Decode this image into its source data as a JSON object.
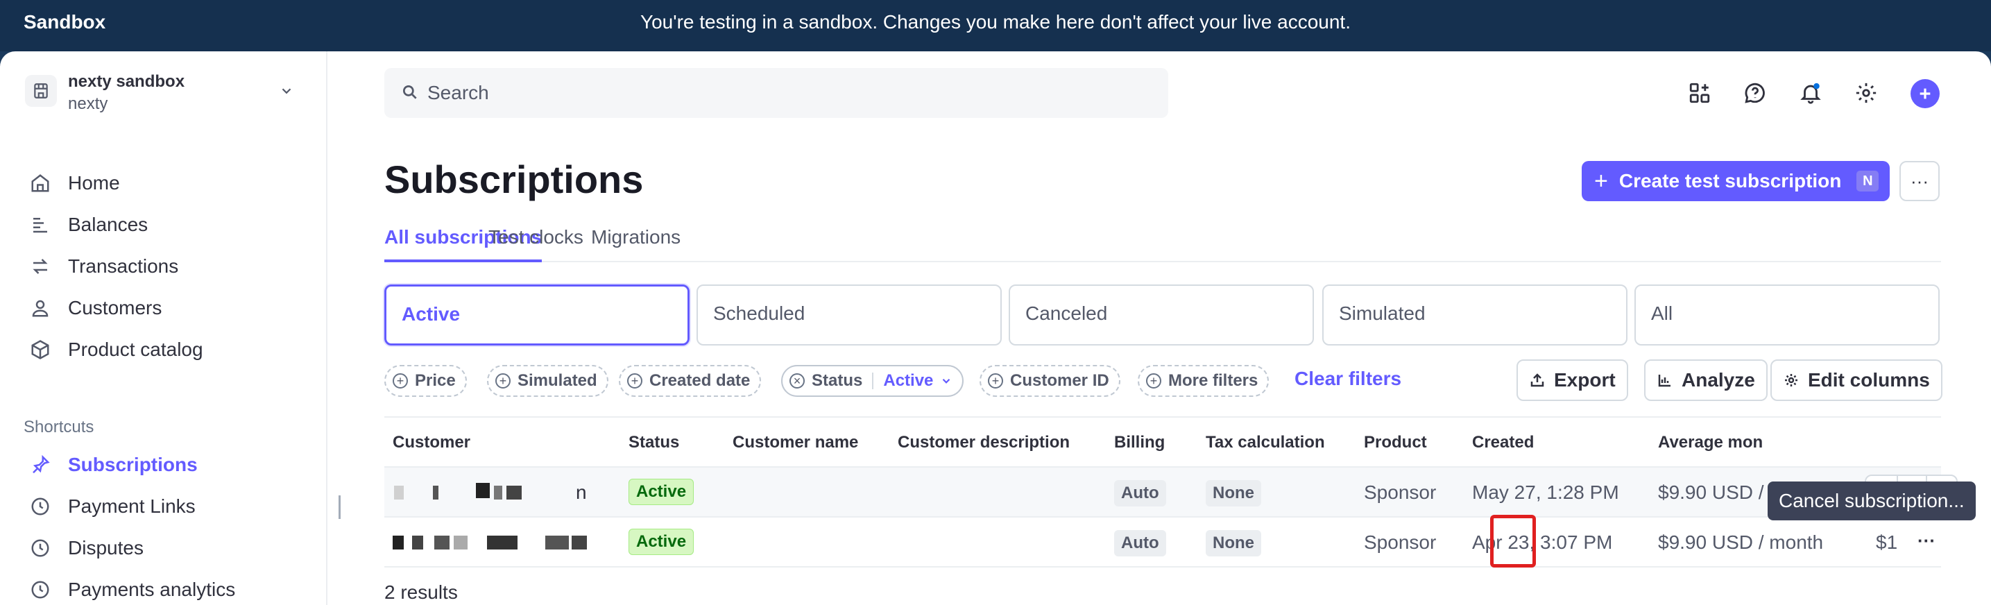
{
  "banner": {
    "brand": "Sandbox",
    "message": "You're testing in a sandbox. Changes you make here don't affect your live account."
  },
  "account": {
    "name": "nexty sandbox",
    "sub": "nexty"
  },
  "nav": {
    "items": [
      {
        "label": "Home",
        "icon": "home-icon"
      },
      {
        "label": "Balances",
        "icon": "balances-icon"
      },
      {
        "label": "Transactions",
        "icon": "transactions-icon"
      },
      {
        "label": "Customers",
        "icon": "customers-icon"
      },
      {
        "label": "Product catalog",
        "icon": "product-catalog-icon"
      }
    ],
    "shortcuts_label": "Shortcuts",
    "shortcuts": [
      {
        "label": "Subscriptions",
        "icon": "subscriptions-icon",
        "active": true
      },
      {
        "label": "Payment Links",
        "icon": "clock-icon"
      },
      {
        "label": "Disputes",
        "icon": "clock-icon"
      },
      {
        "label": "Payments analytics",
        "icon": "clock-icon"
      }
    ]
  },
  "search": {
    "placeholder": "Search"
  },
  "page": {
    "title": "Subscriptions",
    "create_label": "Create test subscription",
    "create_shortcut": "N",
    "more_label": "···"
  },
  "tabs": [
    "All subscriptions",
    "Test clocks",
    "Migrations"
  ],
  "status_filters": [
    "Active",
    "Scheduled",
    "Canceled",
    "Simulated",
    "All"
  ],
  "chips": {
    "price": "Price",
    "simulated": "Simulated",
    "created_date": "Created date",
    "status": "Status",
    "status_value": "Active",
    "customer_id": "Customer ID",
    "more_filters": "More filters",
    "clear": "Clear filters"
  },
  "toolbar": {
    "export": "Export",
    "analyze": "Analyze",
    "edit_columns": "Edit columns"
  },
  "table": {
    "columns": [
      "Customer",
      "Status",
      "Customer name",
      "Customer description",
      "Billing",
      "Tax calculation",
      "Product",
      "Created",
      "Average mon"
    ],
    "rows": [
      {
        "customer_tail": "n",
        "status": "Active",
        "billing": "Auto",
        "tax": "None",
        "product": "Sponsor",
        "created": "May 27, 1:28 PM",
        "avg": "$9.90 USD / month"
      },
      {
        "customer_tail": "",
        "status": "Active",
        "billing": "Auto",
        "tax": "None",
        "product": "Sponsor",
        "created": "Apr 23, 3:07 PM",
        "avg": "$9.90 USD / month",
        "extra": "$1"
      }
    ],
    "results": "2 results"
  },
  "tooltip": "Cancel subscription...",
  "colors": {
    "accent": "#635bff",
    "banner": "#15304f",
    "active_badge": "#d7f7c2",
    "highlight": "#e02020"
  }
}
